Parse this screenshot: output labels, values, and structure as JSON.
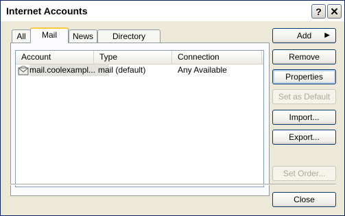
{
  "window": {
    "title": "Internet Accounts"
  },
  "titlebar_buttons": {
    "help": "?",
    "close": "✕"
  },
  "tabs": [
    {
      "label": "All"
    },
    {
      "label": "Mail"
    },
    {
      "label": "News"
    },
    {
      "label": "Directory Service"
    }
  ],
  "list": {
    "columns": [
      "Account",
      "Type",
      "Connection"
    ],
    "rows": [
      {
        "account": "mail.coolexampl...",
        "type": "mail (default)",
        "connection": "Any Available",
        "icon": "mail-account-icon"
      }
    ]
  },
  "buttons": {
    "add": "Add",
    "remove": "Remove",
    "properties": "Properties",
    "set_default": "Set as Default",
    "import": "Import...",
    "export": "Export...",
    "set_order": "Set Order...",
    "close": "Close"
  }
}
